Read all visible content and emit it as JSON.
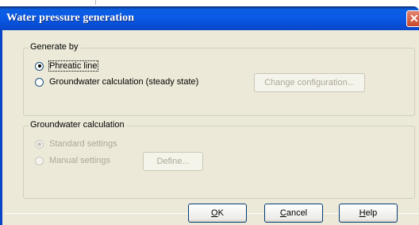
{
  "window": {
    "title": "Water pressure generation"
  },
  "groups": {
    "generate_by": {
      "label": "Generate by",
      "options": [
        {
          "label": "Phreatic line",
          "selected": true
        },
        {
          "label": "Groundwater calculation (steady state)",
          "selected": false
        }
      ],
      "change_configuration_label": "Change configuration..."
    },
    "groundwater": {
      "label": "Groundwater calculation",
      "options": [
        {
          "label": "Standard settings",
          "selected": true
        },
        {
          "label": "Manual settings",
          "selected": false
        }
      ],
      "define_label": "Define..."
    }
  },
  "buttons": {
    "ok": {
      "mnemonic": "O",
      "rest": "K"
    },
    "cancel": {
      "mnemonic": "C",
      "rest": "ancel"
    },
    "help": {
      "mnemonic": "H",
      "rest": "elp"
    }
  },
  "colors": {
    "titlebar": "#0a5ae8",
    "dialog_bg": "#ece9d8",
    "disabled_text": "#aca899",
    "radio_dot": "#21a121"
  }
}
